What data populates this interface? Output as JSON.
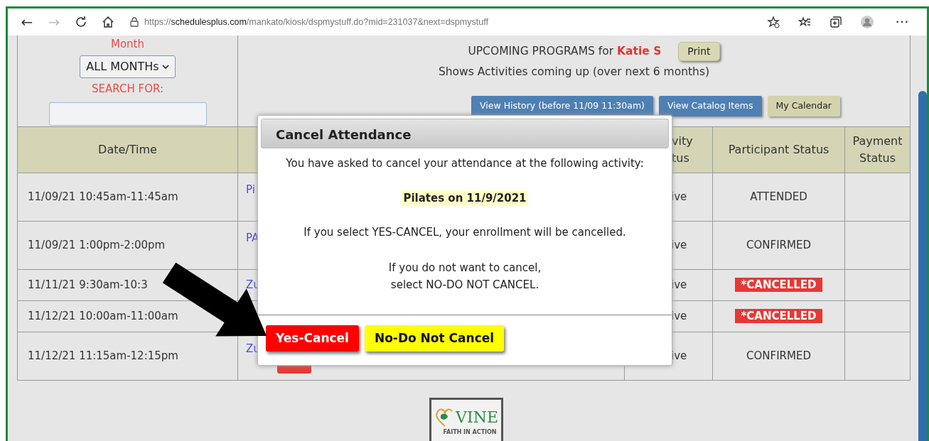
{
  "browser": {
    "back": "←",
    "forward": "→",
    "url": "https://**schedulesplus.com**/mankato/kiosk/dspmystuff.do?mid=231037&next=dspmystuff",
    "forward_disabled": true,
    "more": "···"
  },
  "filter": {
    "month_label": "Month",
    "month_value": "ALL MONTHs",
    "search_label": "SEARCH FOR:"
  },
  "header": {
    "title": "UPCOMING PROGRAMS for **Katie S**",
    "print": "Print",
    "subtitle": "Shows Activities coming up (over next 6 months)"
  },
  "nav_buttons": [
    {
      "label": "View History (before 11/09 11:30am)",
      "kind": "blue"
    },
    {
      "label": "View Catalog Items",
      "kind": "blue"
    },
    {
      "label": "My Calendar",
      "kind": "tan"
    }
  ],
  "table": {
    "columns": [
      "Date/Time",
      "",
      "vity\ntus",
      "Participant Status",
      "Payment Status"
    ],
    "rows": [
      {
        "date": "11/09/21 10:45am-11:45am",
        "activity": "Pi",
        "activity_status": "ive",
        "participant_status": "ATTENDED",
        "kind": "text",
        "cancel_button": false
      },
      {
        "date": "11/09/21 1:00pm-2:00pm",
        "activity": "PA",
        "activity_status": "ive",
        "participant_status": "CONFIRMED",
        "kind": "text",
        "cancel_button": false
      },
      {
        "date": "11/11/21 9:30am-10:3",
        "activity": "Zu",
        "activity_status": "ive",
        "participant_status": "*CANCELLED",
        "kind": "badge",
        "cancel_button": false
      },
      {
        "date": "11/12/21 10:00am-11:00am",
        "activity_status": "ive",
        "participant_status": "*CANCELLED",
        "kind": "badge",
        "cancel_button": false
      },
      {
        "date": "11/12/21 11:15am-12:15pm",
        "activity": "Zu",
        "activity_status": "ive",
        "participant_status": "CONFIRMED",
        "kind": "text",
        "cancel_button": true
      }
    ]
  },
  "dialog": {
    "title": "Cancel Attendance",
    "intro": "You have asked to cancel your attendance at the following activity:",
    "activity": "Pilates on 11/9/2021",
    "warning": "If you select YES-CANCEL, your enrollment will be cancelled.",
    "hint": "If you do not want to cancel,\nselect NO-DO NOT CANCEL.",
    "confirm": "Yes-Cancel",
    "dismiss": "No-Do Not Cancel"
  },
  "logo": {
    "name": "VINE",
    "tagline": "FAITH IN ACTION"
  }
}
